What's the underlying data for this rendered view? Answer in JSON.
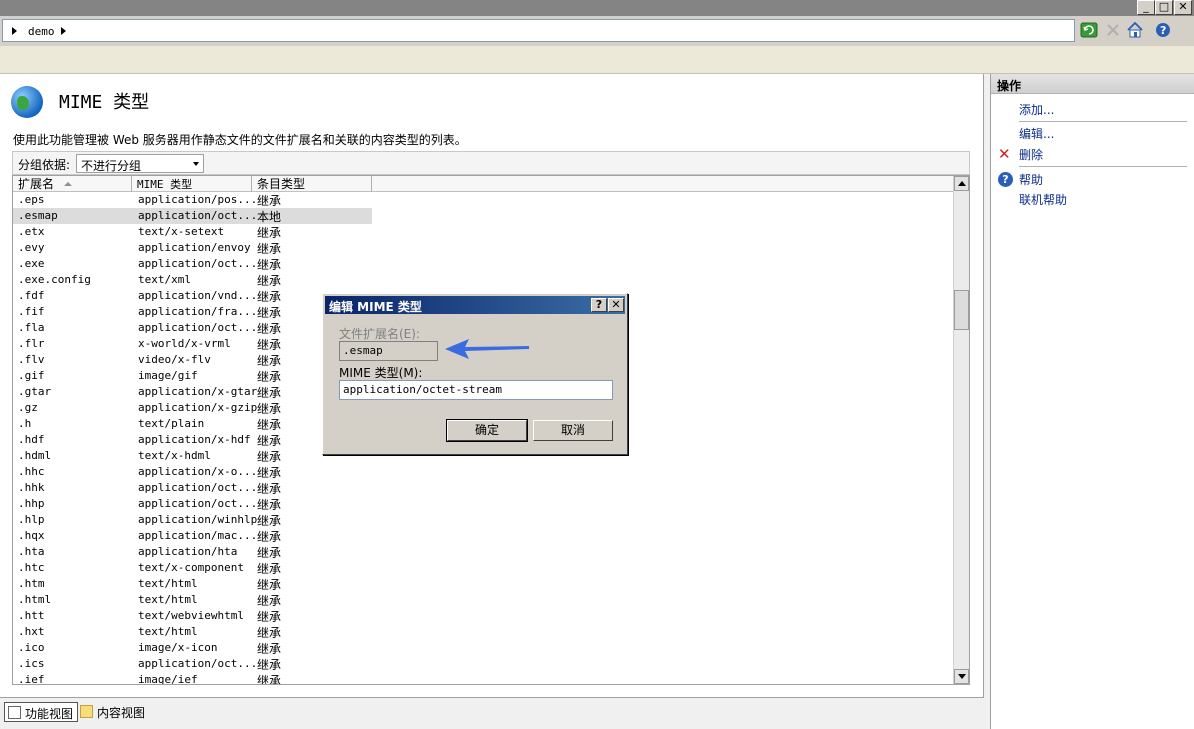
{
  "titlebar": {
    "min": "_",
    "max": "□",
    "close": "✕"
  },
  "address": {
    "crumb": "demo"
  },
  "colors": {
    "accent": "#0a246a",
    "link": "#0b2d8c",
    "arrow": "#3a6be0",
    "delete": "#d02020"
  },
  "page": {
    "title": "MIME 类型",
    "description": "使用此功能管理被 Web 服务器用作静态文件的文件扩展名和关联的内容类型的列表。",
    "group_label": "分组依据:",
    "group_value": "不进行分组"
  },
  "list": {
    "headers": [
      "扩展名",
      "MIME 类型",
      "条目类型"
    ],
    "rows": [
      [
        ".eps",
        "application/pos...",
        "继承"
      ],
      [
        ".esmap",
        "application/oct...",
        "本地"
      ],
      [
        ".etx",
        "text/x-setext",
        "继承"
      ],
      [
        ".evy",
        "application/envoy",
        "继承"
      ],
      [
        ".exe",
        "application/oct...",
        "继承"
      ],
      [
        ".exe.config",
        "text/xml",
        "继承"
      ],
      [
        ".fdf",
        "application/vnd...",
        "继承"
      ],
      [
        ".fif",
        "application/fra...",
        "继承"
      ],
      [
        ".fla",
        "application/oct...",
        "继承"
      ],
      [
        ".flr",
        "x-world/x-vrml",
        "继承"
      ],
      [
        ".flv",
        "video/x-flv",
        "继承"
      ],
      [
        ".gif",
        "image/gif",
        "继承"
      ],
      [
        ".gtar",
        "application/x-gtar",
        "继承"
      ],
      [
        ".gz",
        "application/x-gzip",
        "继承"
      ],
      [
        ".h",
        "text/plain",
        "继承"
      ],
      [
        ".hdf",
        "application/x-hdf",
        "继承"
      ],
      [
        ".hdml",
        "text/x-hdml",
        "继承"
      ],
      [
        ".hhc",
        "application/x-o...",
        "继承"
      ],
      [
        ".hhk",
        "application/oct...",
        "继承"
      ],
      [
        ".hhp",
        "application/oct...",
        "继承"
      ],
      [
        ".hlp",
        "application/winhlp",
        "继承"
      ],
      [
        ".hqx",
        "application/mac...",
        "继承"
      ],
      [
        ".hta",
        "application/hta",
        "继承"
      ],
      [
        ".htc",
        "text/x-component",
        "继承"
      ],
      [
        ".htm",
        "text/html",
        "继承"
      ],
      [
        ".html",
        "text/html",
        "继承"
      ],
      [
        ".htt",
        "text/webviewhtml",
        "继承"
      ],
      [
        ".hxt",
        "text/html",
        "继承"
      ],
      [
        ".ico",
        "image/x-icon",
        "继承"
      ],
      [
        ".ics",
        "application/oct...",
        "继承"
      ],
      [
        ".ief",
        "image/ief",
        "继承"
      ]
    ],
    "selected_row": 1
  },
  "bottom_tabs": {
    "features": "功能视图",
    "content": "内容视图"
  },
  "actions": {
    "title": "操作",
    "add": "添加...",
    "edit": "编辑...",
    "delete": "删除",
    "help": "帮助",
    "online_help": "联机帮助"
  },
  "dialog": {
    "title": "编辑 MIME 类型",
    "help_btn": "?",
    "close_btn": "✕",
    "ext_label": "文件扩展名(E):",
    "ext_value": ".esmap",
    "mime_label": "MIME 类型(M):",
    "mime_value": "application/octet-stream",
    "ok": "确定",
    "cancel": "取消"
  }
}
